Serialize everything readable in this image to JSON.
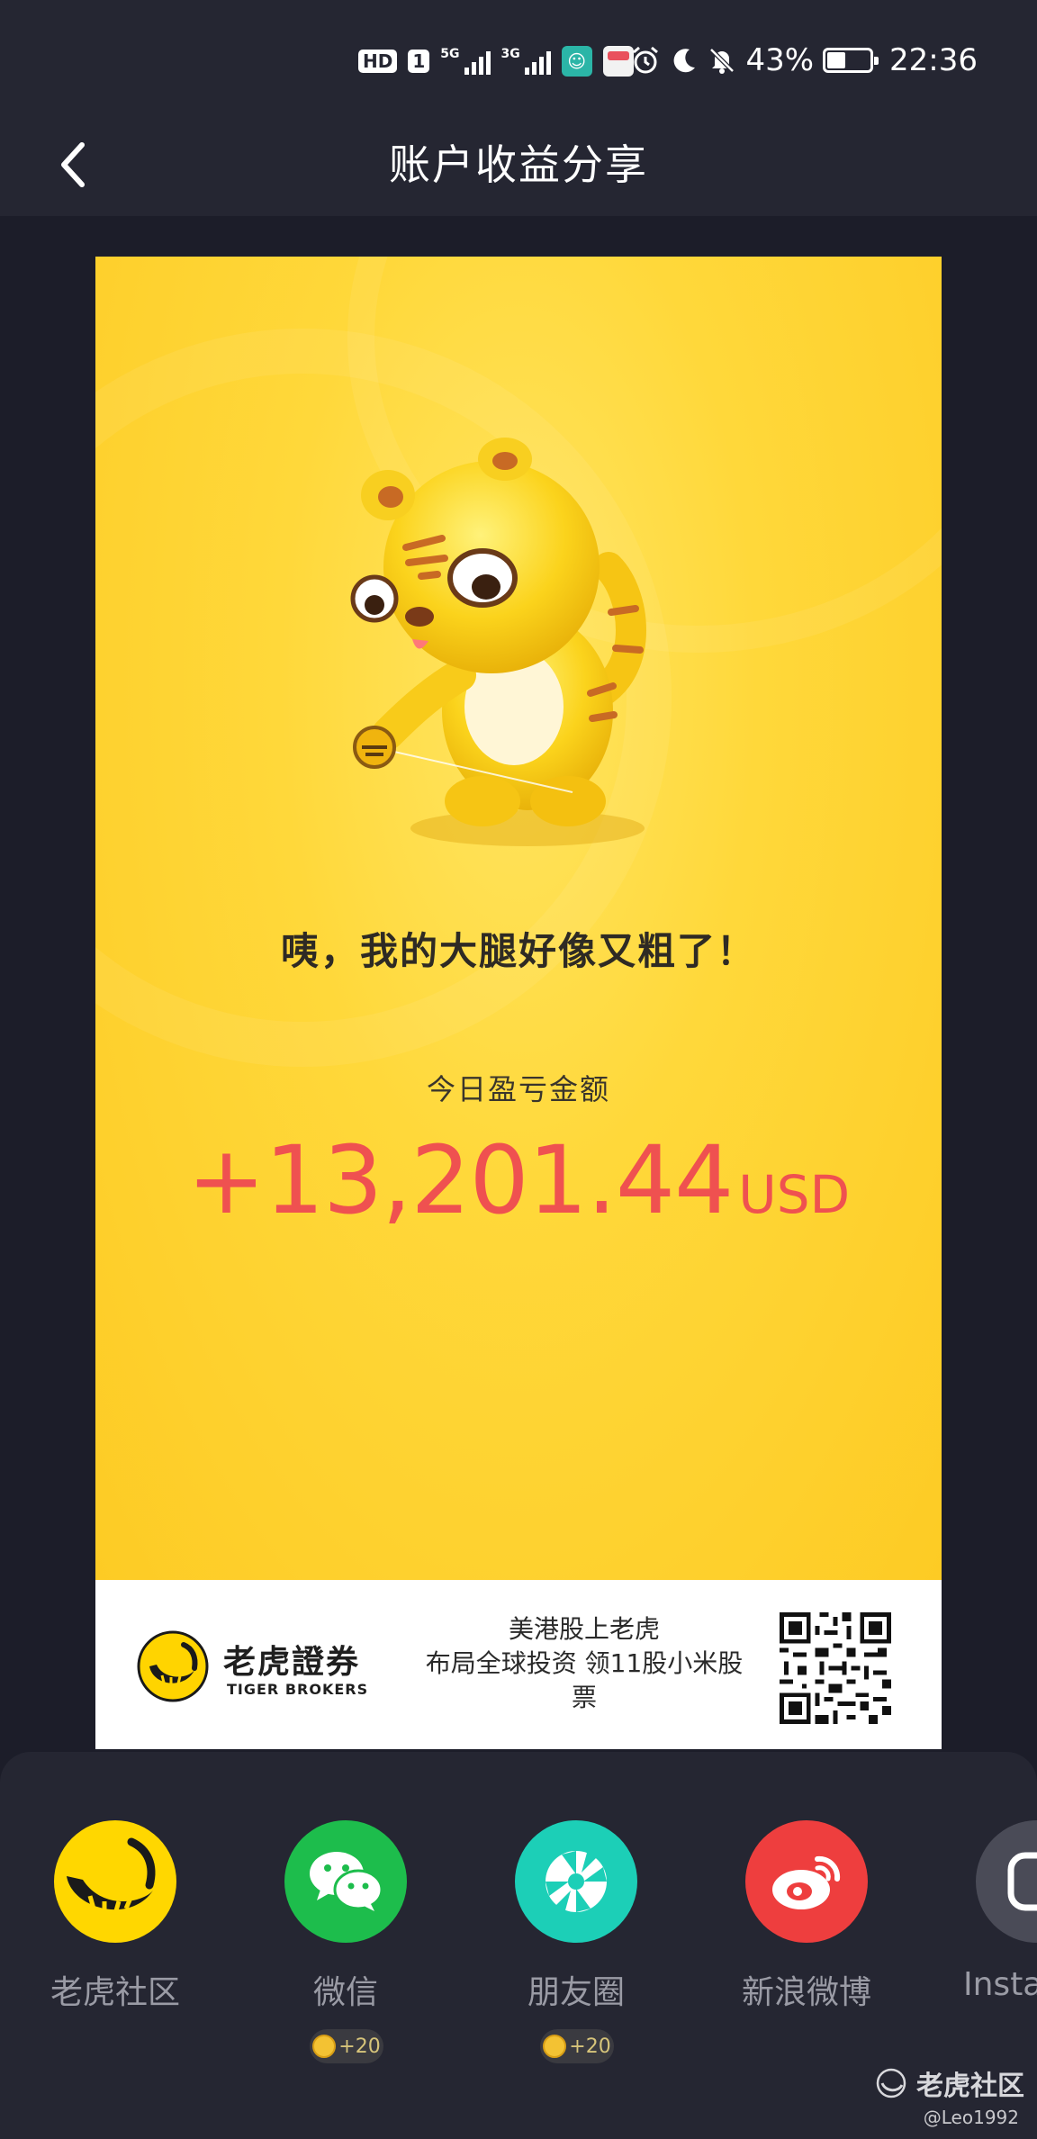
{
  "status_bar": {
    "hd": "HD",
    "sim1": "1",
    "net1": "5G",
    "net2": "3G",
    "battery": "43%",
    "battery_level": 0.43,
    "time": "22:36",
    "icons": [
      "alarm-icon",
      "moon-icon",
      "mute-bell-icon",
      "battery-icon"
    ]
  },
  "nav": {
    "title": "账户收益分享",
    "back_icon": "chevron-left-icon"
  },
  "card": {
    "slogan": "咦，我的大腿好像又粗了！",
    "pl_label": "今日盈亏金额",
    "pl_amount": "+13,201.44",
    "pl_currency": "USD",
    "accent_color": "#ef5150",
    "brand_name": "老虎證券",
    "brand_sub": "TIGER BROKERS",
    "promo_line1": "美港股上老虎",
    "promo_line2": "布局全球投资 领11股小米股票"
  },
  "share": {
    "items": [
      {
        "label": "老虎社区",
        "icon": "tiger-community-icon",
        "color": "#ffd700"
      },
      {
        "label": "微信",
        "icon": "wechat-icon",
        "color": "#1dbd4c",
        "reward": "+20"
      },
      {
        "label": "朋友圈",
        "icon": "moments-icon",
        "color": "#1ccfb7",
        "reward": "+20"
      },
      {
        "label": "新浪微博",
        "icon": "weibo-icon",
        "color": "#ee3e3e"
      },
      {
        "label": "Insta",
        "icon": "instagram-icon",
        "color": "#4a4b57"
      }
    ],
    "watermark": "老虎社区",
    "watermark_user": "@Leo1992"
  }
}
